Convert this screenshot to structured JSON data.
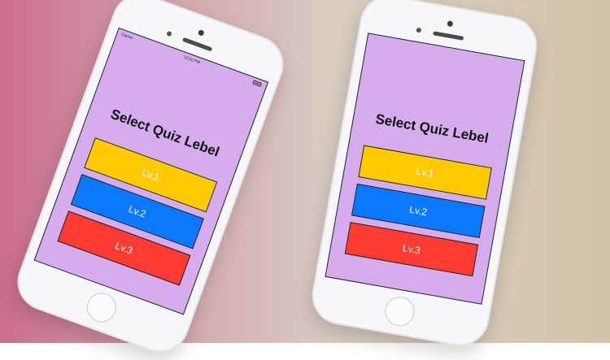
{
  "colors": {
    "screen_background": "#d5aded",
    "level1": "#ffcb00",
    "level2": "#0b79ff",
    "level3": "#ff3b33"
  },
  "phones": [
    {
      "carrier": "Carrier",
      "time": "12:52 PM",
      "title": "Select Quiz Lebel",
      "buttons": [
        "Lv.1",
        "Lv.2",
        "Lv.3"
      ]
    },
    {
      "carrier": "",
      "time": "",
      "title": "Select Quiz Lebel",
      "buttons": [
        "Lv.1",
        "Lv.2",
        "Lv.3"
      ]
    }
  ]
}
